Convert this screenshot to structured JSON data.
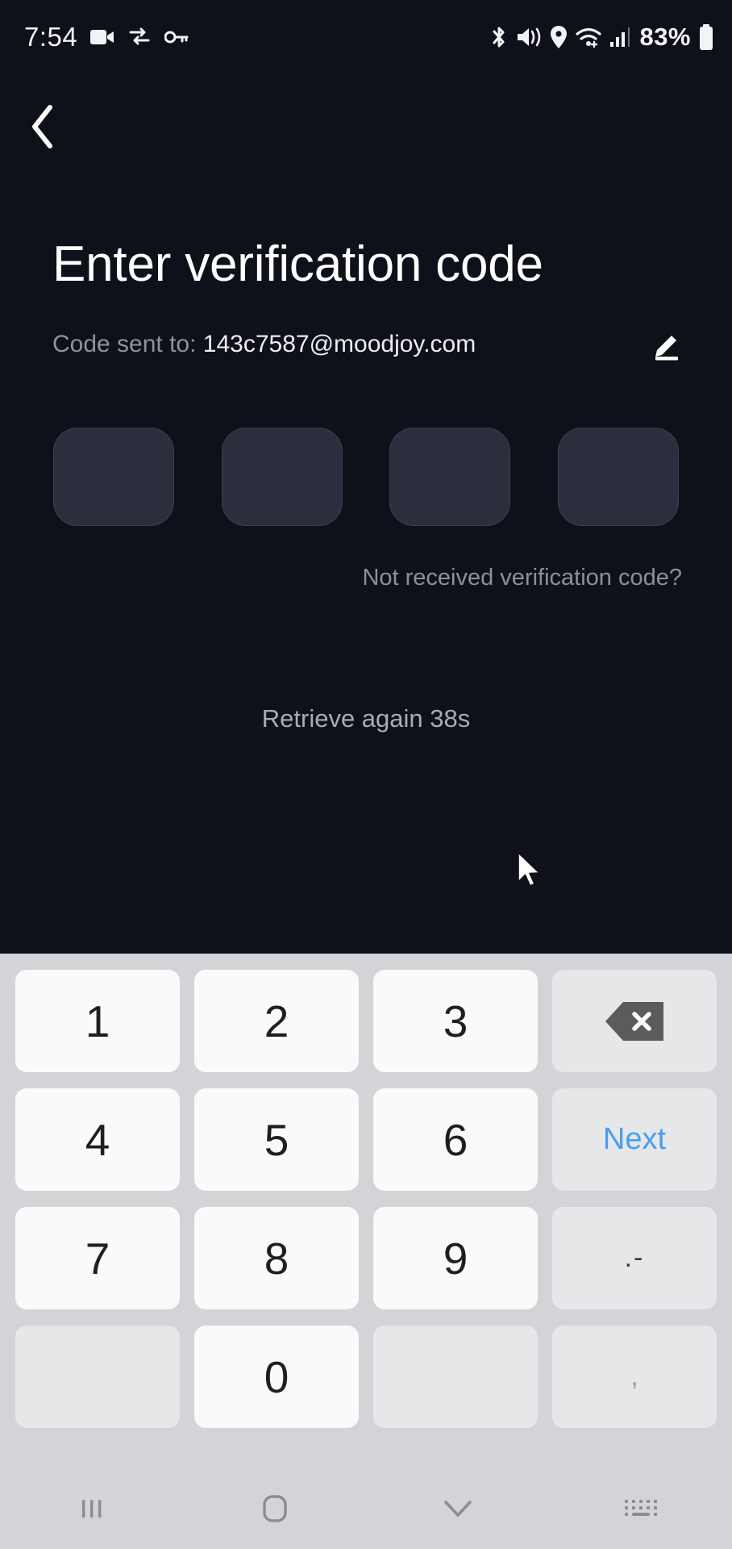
{
  "status_bar": {
    "time": "7:54",
    "battery_percent": "83%",
    "left_icons": [
      "video-camera-icon",
      "vpn-key-exchange-icon",
      "key-icon"
    ],
    "right_icons": [
      "bluetooth-icon",
      "vibrate-mute-icon",
      "location-icon",
      "wifi-icon",
      "cellular-signal-icon",
      "battery-icon"
    ]
  },
  "nav": {
    "back_icon": "chevron-left-icon"
  },
  "screen": {
    "title": "Enter verification code",
    "sent_label": "Code sent to:",
    "email": "143c7587@moodjoy.com",
    "edit_icon": "pencil-edit-icon",
    "otp_values": [
      "",
      "",
      "",
      ""
    ],
    "not_received": "Not received verification code?",
    "retrieve": "Retrieve again 38s"
  },
  "keyboard": {
    "rows": [
      [
        {
          "label": "1",
          "name": "key-1",
          "type": "num"
        },
        {
          "label": "2",
          "name": "key-2",
          "type": "num"
        },
        {
          "label": "3",
          "name": "key-3",
          "type": "num"
        },
        {
          "label": "",
          "name": "key-backspace",
          "type": "backspace"
        }
      ],
      [
        {
          "label": "4",
          "name": "key-4",
          "type": "num"
        },
        {
          "label": "5",
          "name": "key-5",
          "type": "num"
        },
        {
          "label": "6",
          "name": "key-6",
          "type": "num"
        },
        {
          "label": "Next",
          "name": "key-next",
          "type": "next"
        }
      ],
      [
        {
          "label": "7",
          "name": "key-7",
          "type": "num"
        },
        {
          "label": "8",
          "name": "key-8",
          "type": "num"
        },
        {
          "label": "9",
          "name": "key-9",
          "type": "num"
        },
        {
          "label": ".-",
          "name": "key-dot-dash",
          "type": "dotdash"
        }
      ],
      [
        {
          "label": "",
          "name": "key-blank-left",
          "type": "blank"
        },
        {
          "label": "0",
          "name": "key-0",
          "type": "num"
        },
        {
          "label": "",
          "name": "key-blank-right",
          "type": "blank"
        },
        {
          "label": ",",
          "name": "key-comma",
          "type": "comma"
        }
      ]
    ]
  },
  "system_nav": {
    "items": [
      {
        "name": "recents-icon"
      },
      {
        "name": "home-icon"
      },
      {
        "name": "hide-keyboard-chevron-icon"
      },
      {
        "name": "keyboard-switcher-icon"
      }
    ]
  },
  "colors": {
    "background": "#0e1119",
    "otp_fill": "#2b2e3c",
    "keyboard_bg": "#d3d4d7",
    "key_bg": "#fafafa",
    "key_fn_bg": "#e6e7e9",
    "next_blue": "#4a9eee"
  }
}
